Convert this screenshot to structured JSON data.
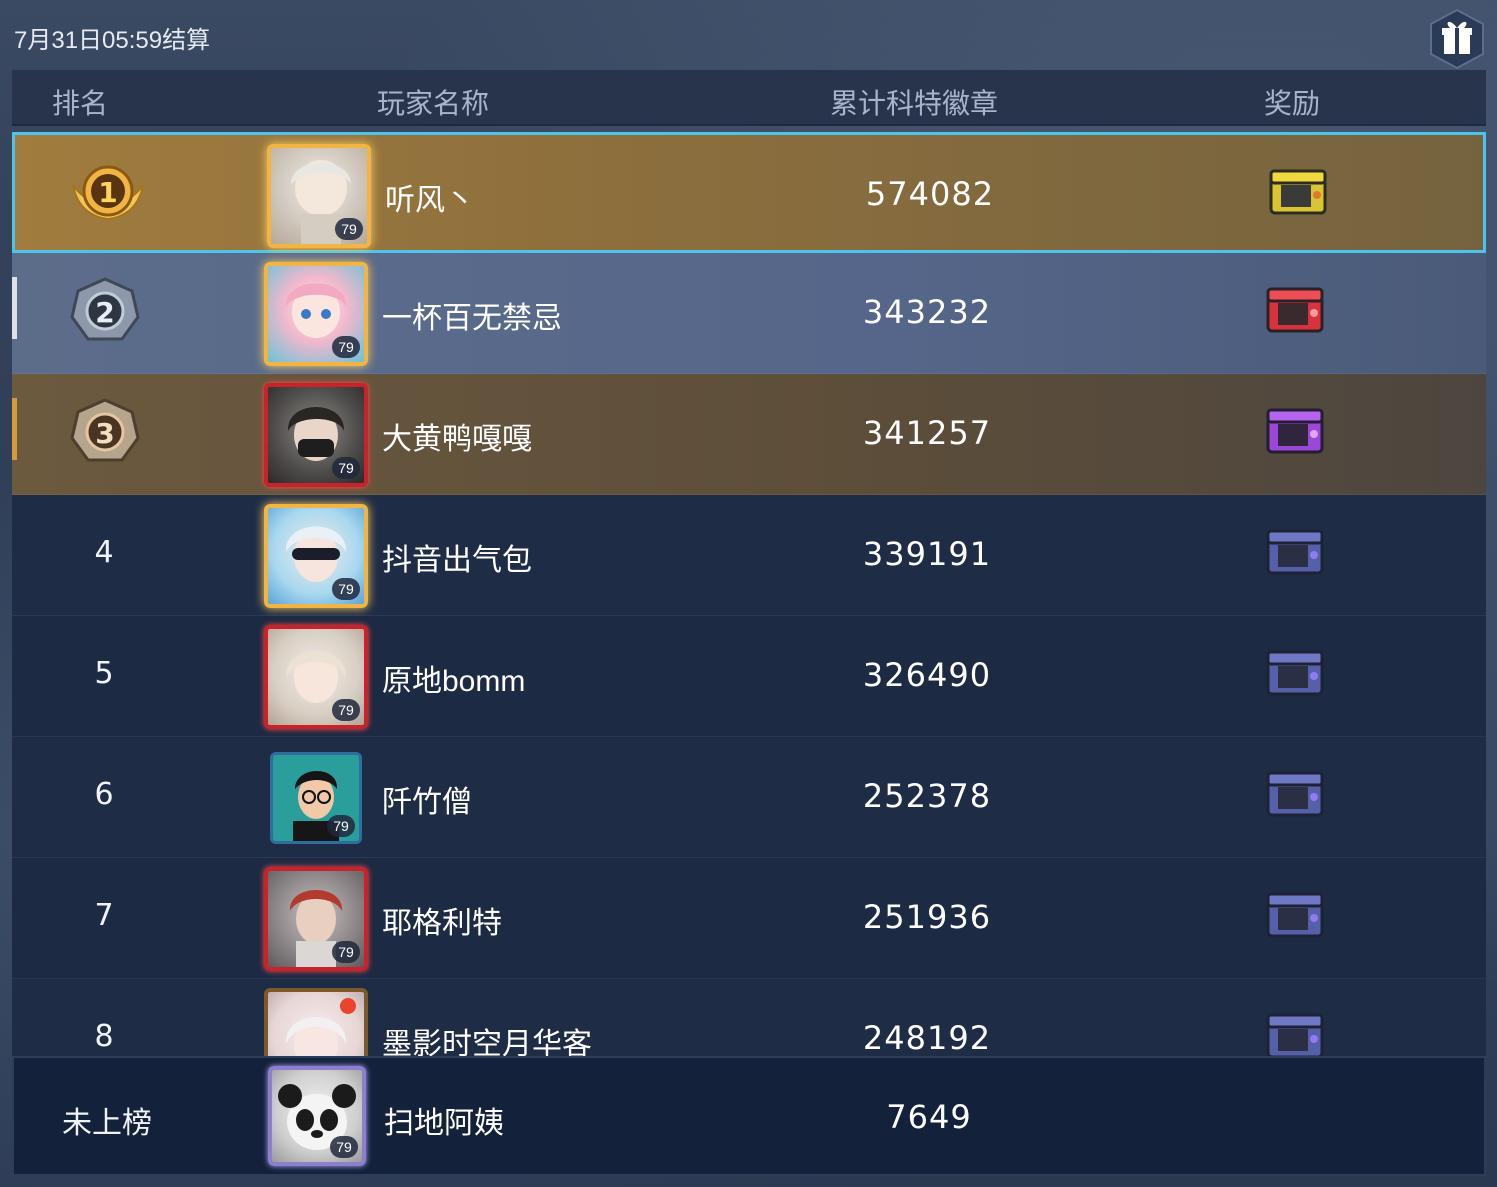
{
  "settlement_time": "7月31日05:59结算",
  "header": {
    "rank": "排名",
    "player_name": "玩家名称",
    "score": "累计科特徽章",
    "reward": "奖励"
  },
  "rows": [
    {
      "rank": "1",
      "name": "听风丶",
      "score": "574082",
      "level": "79",
      "chest": "gold-chest-icon"
    },
    {
      "rank": "2",
      "name": "一杯百无禁忌",
      "score": "343232",
      "level": "79",
      "chest": "red-chest-icon"
    },
    {
      "rank": "3",
      "name": "大黄鸭嘎嘎",
      "score": "341257",
      "level": "79",
      "chest": "purple-chest-icon"
    },
    {
      "rank": "4",
      "name": "抖音出气包",
      "score": "339191",
      "level": "79",
      "chest": "blue-chest-icon"
    },
    {
      "rank": "5",
      "name": "原地bomm",
      "score": "326490",
      "level": "79",
      "chest": "blue-chest-icon"
    },
    {
      "rank": "6",
      "name": "阡竹僧",
      "score": "252378",
      "level": "79",
      "chest": "blue-chest-icon"
    },
    {
      "rank": "7",
      "name": "耶格利特",
      "score": "251936",
      "level": "79",
      "chest": "blue-chest-icon"
    },
    {
      "rank": "8",
      "name": "墨影时空月华客",
      "score": "248192",
      "level": "",
      "chest": "blue-chest-icon"
    }
  ],
  "self": {
    "rank": "未上榜",
    "name": "扫地阿姨",
    "score": "7649",
    "level": "79"
  },
  "colors": {
    "highlight_border": "#4fc3ea",
    "gold": "#f2b544",
    "row_dark": "#1f2c46",
    "header_text": "#a9b4c8"
  }
}
